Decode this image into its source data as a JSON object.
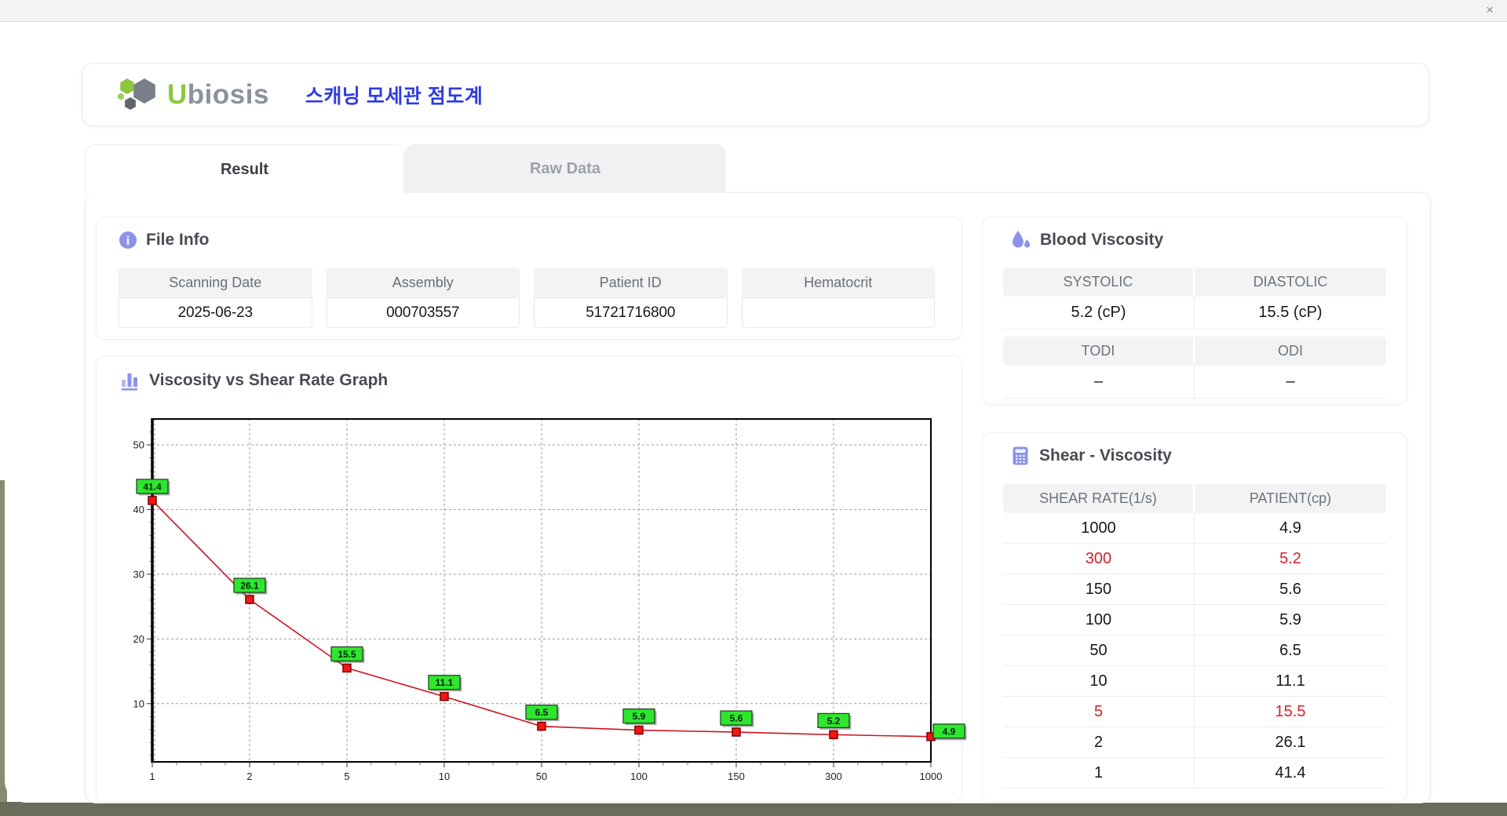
{
  "window": {
    "close_label": "×"
  },
  "header": {
    "logo_u": "U",
    "logo_rest": "biosis",
    "app_title": "스캐닝 모세관 점도계"
  },
  "tabs": {
    "result": "Result",
    "raw_data": "Raw Data"
  },
  "file_info": {
    "title": "File Info",
    "fields": [
      {
        "label": "Scanning Date",
        "value": "2025-06-23"
      },
      {
        "label": "Assembly",
        "value": "000703557"
      },
      {
        "label": "Patient ID",
        "value": "51721716800"
      },
      {
        "label": "Hematocrit",
        "value": ""
      }
    ]
  },
  "blood_viscosity": {
    "title": "Blood Viscosity",
    "systolic_label": "SYSTOLIC",
    "diastolic_label": "DIASTOLIC",
    "systolic_value": "5.2 (cP)",
    "diastolic_value": "15.5 (cP)",
    "todi_label": "TODI",
    "odi_label": "ODI",
    "todi_value": "–",
    "odi_value": "–"
  },
  "graph": {
    "title": "Viscosity vs Shear Rate Graph"
  },
  "chart_data": {
    "type": "line",
    "title": "Viscosity vs Shear Rate Graph",
    "xlabel": "",
    "ylabel": "",
    "x": [
      1,
      2,
      5,
      10,
      50,
      100,
      150,
      300,
      1000
    ],
    "x_axis_scale": "categorical-even-spacing",
    "series": [
      {
        "name": "PATIENT",
        "values": [
          41.4,
          26.1,
          15.5,
          11.1,
          6.5,
          5.9,
          5.6,
          5.2,
          4.9
        ]
      }
    ],
    "point_labels": [
      "41.4",
      "26.1",
      "15.5",
      "11.1",
      "6.5",
      "5.9",
      "5.6",
      "5.2",
      "4.9"
    ],
    "yticks": [
      10,
      20,
      30,
      40,
      50
    ],
    "ylim": [
      1,
      54
    ],
    "grid": true,
    "grid_style": "dashed",
    "legend": "none",
    "line_color": "#cf1322",
    "marker_color": "#f21616",
    "marker_edge": "#7d0000",
    "label_bg": "#2ee62e"
  },
  "shear_viscosity": {
    "title": "Shear - Viscosity",
    "columns": [
      "SHEAR RATE(1/s)",
      "PATIENT(cp)"
    ],
    "rows": [
      {
        "rate": "1000",
        "value": "4.9",
        "highlight": false
      },
      {
        "rate": "300",
        "value": "5.2",
        "highlight": true
      },
      {
        "rate": "150",
        "value": "5.6",
        "highlight": false
      },
      {
        "rate": "100",
        "value": "5.9",
        "highlight": false
      },
      {
        "rate": "50",
        "value": "6.5",
        "highlight": false
      },
      {
        "rate": "10",
        "value": "11.1",
        "highlight": false
      },
      {
        "rate": "5",
        "value": "15.5",
        "highlight": true
      },
      {
        "rate": "2",
        "value": "26.1",
        "highlight": false
      },
      {
        "rate": "1",
        "value": "41.4",
        "highlight": false
      }
    ]
  },
  "colors": {
    "accent_purple": "#8b93ea",
    "title_blue": "#2f3be2",
    "logo_green": "#8dc63f",
    "highlight_red": "#d3222a",
    "chart_line": "#cf1322",
    "chart_label_bg": "#2ee62e",
    "desktop_olive": "#6c6c5b",
    "header_cell_bg": "#f3f3f4"
  }
}
